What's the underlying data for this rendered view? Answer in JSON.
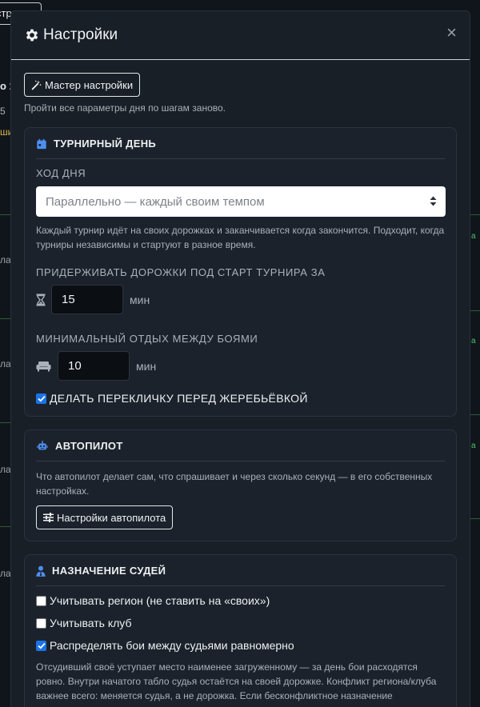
{
  "background": {
    "top_button_label": "стр",
    "fragments": [
      "о 1",
      "5",
      "ши",
      "ла",
      "ла",
      "ла",
      "ла"
    ],
    "green_fragments": [
      "а",
      "а",
      "а"
    ]
  },
  "modal": {
    "title": "Настройки",
    "close_label": "×"
  },
  "wizard": {
    "button_label": "Мастер настройки",
    "hint": "Пройти все параметры дня по шагам заново."
  },
  "tournament_day": {
    "title": "ТУРНИРНЫЙ ДЕНЬ",
    "flow_label": "ХОД ДНЯ",
    "flow_selected": "Параллельно — каждый своим темпом",
    "flow_hint": "Каждый турнир идёт на своих дорожках и заканчивается когда закончится. Подходит, когда турниры независимы и стартуют в разное время.",
    "hold_label": "ПРИДЕРЖИВАТЬ ДОРОЖКИ ПОД СТАРТ ТУРНИРА ЗА",
    "hold_value": "15",
    "hold_unit": "мин",
    "rest_label": "МИНИМАЛЬНЫЙ ОТДЫХ МЕЖДУ БОЯМИ",
    "rest_value": "10",
    "rest_unit": "мин",
    "rollcall_label": "ДЕЛАТЬ ПЕРЕКЛИЧКУ ПЕРЕД ЖЕРЕБЬЁВКОЙ",
    "rollcall_checked": true
  },
  "autopilot": {
    "title": "АВТОПИЛОТ",
    "hint": "Что автопилот делает сам, что спрашивает и через сколько секунд — в его собственных настройках.",
    "button_label": "Настройки автопилота"
  },
  "judges": {
    "title": "НАЗНАЧЕНИЕ СУДЕЙ",
    "options": [
      {
        "label": "Учитывать регион (не ставить на «своих»)",
        "checked": false
      },
      {
        "label": "Учитывать клуб",
        "checked": false
      },
      {
        "label": "Распределять бои между судьями равномерно",
        "checked": true
      }
    ],
    "hint": "Отсудивший своё уступает место наименее загруженному — за день бои расходятся ровно. Внутри начатого табло судья остаётся на своей дорожке. Конфликт региона/клуба важнее всего: меняется судья, а не дорожка. Если бесконфликтное назначение невозможно, арена явно предупредит."
  },
  "colors": {
    "accent": "#1a73e8",
    "modal_bg": "#191f27",
    "card_bg": "#1b222b"
  }
}
